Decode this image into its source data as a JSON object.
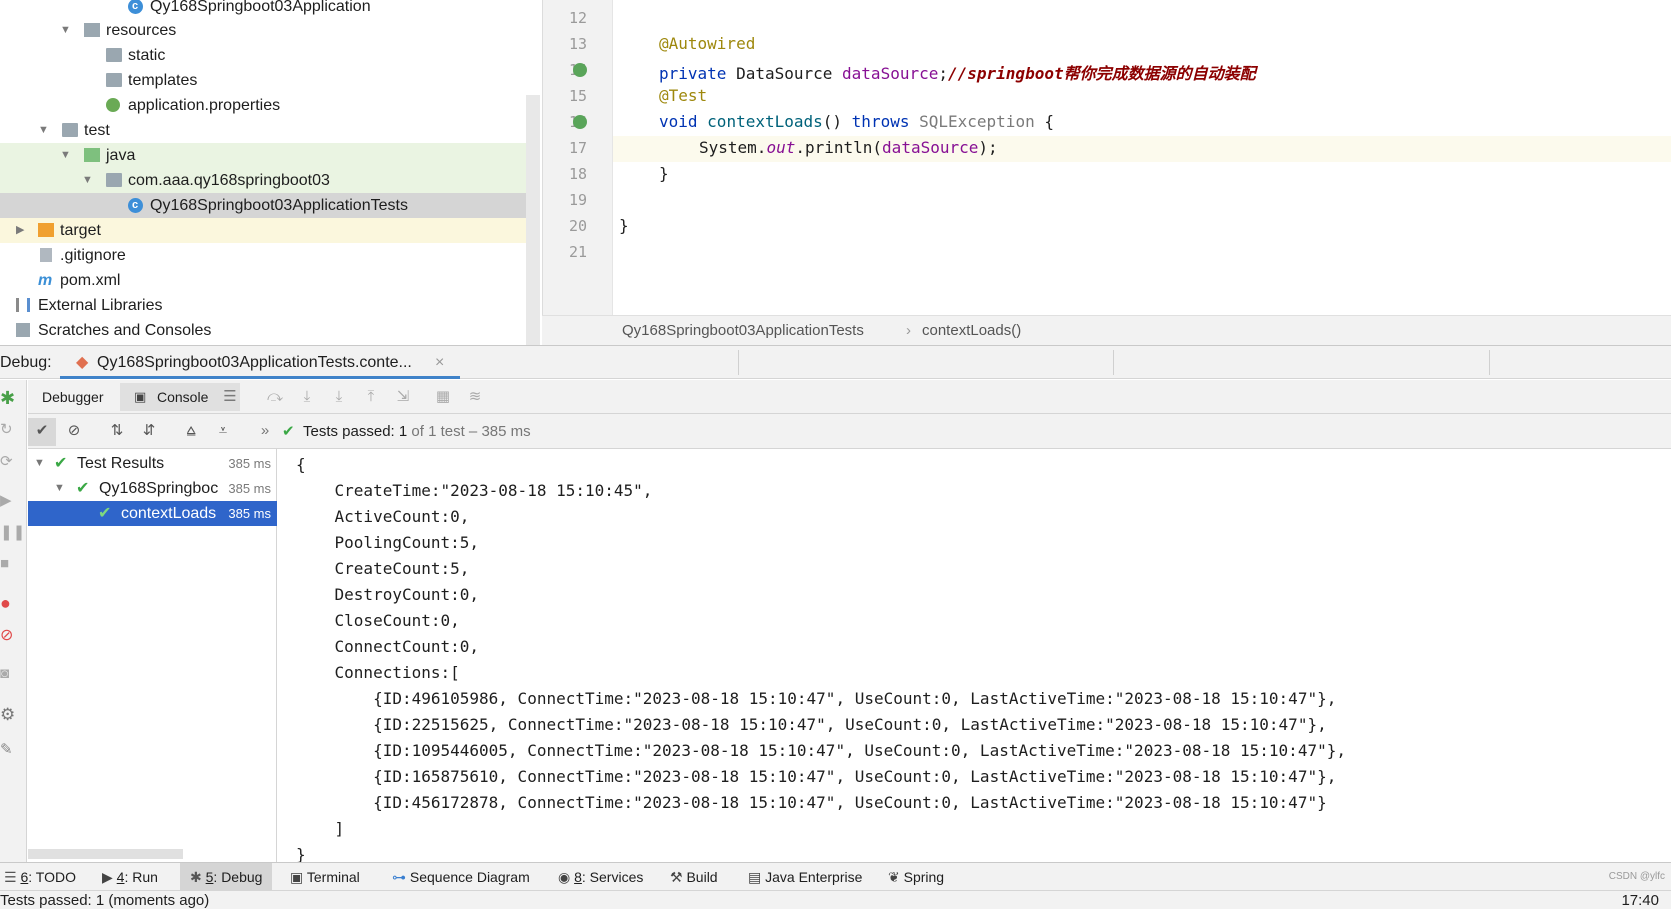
{
  "project_tree": {
    "items": [
      {
        "label": "Qy168Springboot03Application",
        "icon": "class-icon"
      },
      {
        "label": "resources",
        "icon": "resources-folder-icon"
      },
      {
        "label": "static",
        "icon": "folder-icon"
      },
      {
        "label": "templates",
        "icon": "folder-icon"
      },
      {
        "label": "application.properties",
        "icon": "properties-file-icon"
      },
      {
        "label": "test",
        "icon": "folder-icon"
      },
      {
        "label": "java",
        "icon": "test-source-folder-icon"
      },
      {
        "label": "com.aaa.qy168springboot03",
        "icon": "package-icon"
      },
      {
        "label": "Qy168Springboot03ApplicationTests",
        "icon": "class-icon"
      },
      {
        "label": "target",
        "icon": "excluded-folder-icon"
      },
      {
        "label": ".gitignore",
        "icon": "file-icon"
      },
      {
        "label": "pom.xml",
        "icon": "maven-icon"
      },
      {
        "label": "External Libraries",
        "icon": "library-icon"
      },
      {
        "label": "Scratches and Consoles",
        "icon": "scratches-icon"
      }
    ]
  },
  "editor": {
    "line_numbers": [
      "12",
      "13",
      "14",
      "15",
      "16",
      "17",
      "18",
      "19",
      "20",
      "21"
    ],
    "code": {
      "autowired": "@Autowired",
      "private_kw": "private",
      "datasource_type": " DataSource ",
      "datasource_field": "dataSource",
      "semicolon": ";",
      "comment": "//springboot帮你完成数据源的自动装配",
      "test_ann": "@Test",
      "void_kw": "void ",
      "method_name": "contextLoads",
      "parens": "() ",
      "throws_kw": "throws ",
      "exception": "SQLException",
      "open_brace": " {",
      "system": "System.",
      "out": "out",
      "println": ".println(",
      "arg": "dataSource",
      "close_call": ");",
      "close_method": "}",
      "close_class": "}"
    },
    "breadcrumb": [
      "Qy168Springboot03ApplicationTests",
      "contextLoads()"
    ]
  },
  "debug": {
    "label": "Debug:",
    "tab": "Qy168Springboot03ApplicationTests.conte...",
    "tabs": {
      "debugger": "Debugger",
      "console": "Console"
    },
    "status_prefix": "Tests passed: ",
    "status_count": "1",
    "status_suffix": " of 1 test – 385 ms",
    "results": [
      {
        "label": "Test Results",
        "time": "385 ms"
      },
      {
        "label": "Qy168Springboc",
        "time": "385 ms"
      },
      {
        "label": "contextLoads",
        "time": "385 ms"
      }
    ],
    "console_lines": [
      "{",
      "    CreateTime:\"2023-08-18 15:10:45\",",
      "    ActiveCount:0,",
      "    PoolingCount:5,",
      "    CreateCount:5,",
      "    DestroyCount:0,",
      "    CloseCount:0,",
      "    ConnectCount:0,",
      "    Connections:[",
      "        {ID:496105986, ConnectTime:\"2023-08-18 15:10:47\", UseCount:0, LastActiveTime:\"2023-08-18 15:10:47\"},",
      "        {ID:22515625, ConnectTime:\"2023-08-18 15:10:47\", UseCount:0, LastActiveTime:\"2023-08-18 15:10:47\"},",
      "        {ID:1095446005, ConnectTime:\"2023-08-18 15:10:47\", UseCount:0, LastActiveTime:\"2023-08-18 15:10:47\"},",
      "        {ID:165875610, ConnectTime:\"2023-08-18 15:10:47\", UseCount:0, LastActiveTime:\"2023-08-18 15:10:47\"},",
      "        {ID:456172878, ConnectTime:\"2023-08-18 15:10:47\", UseCount:0, LastActiveTime:\"2023-08-18 15:10:47\"}",
      "    ]",
      "}"
    ]
  },
  "tool_windows": [
    {
      "num": "6",
      "label": ": TODO"
    },
    {
      "num": "4",
      "label": ": Run"
    },
    {
      "num": "5",
      "label": ": Debug"
    },
    {
      "num": "",
      "label": "Terminal"
    },
    {
      "num": "",
      "label": "Sequence Diagram"
    },
    {
      "num": "8",
      "label": ": Services"
    },
    {
      "num": "",
      "label": "Build"
    },
    {
      "num": "",
      "label": "Java Enterprise"
    },
    {
      "num": "",
      "label": "Spring"
    }
  ],
  "status_bar": {
    "text": "Tests passed: 1 (moments ago)",
    "time": "17:40",
    "watermark": "CSDN @ylfc"
  }
}
